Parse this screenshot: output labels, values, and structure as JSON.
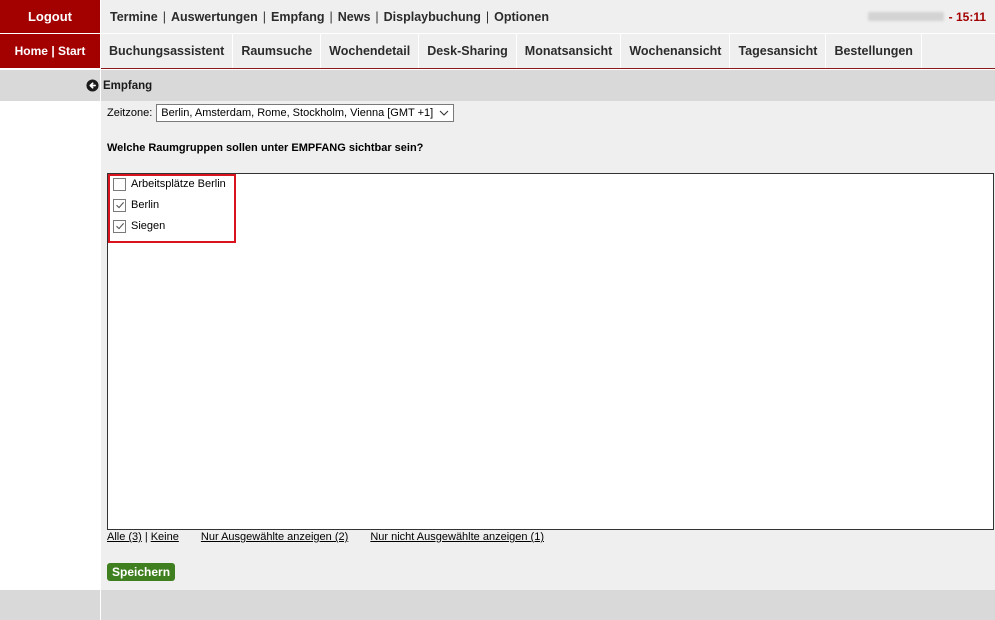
{
  "sidebar": {
    "logout_label": "Logout",
    "home_label": "Home | Start"
  },
  "top_nav": {
    "links": [
      "Termine",
      "Auswertungen",
      "Empfang",
      "News",
      "Displaybuchung",
      "Optionen"
    ],
    "separator": "|",
    "time": "15:11"
  },
  "tabs": [
    "Buchungsassistent",
    "Raumsuche",
    "Wochendetail",
    "Desk-Sharing",
    "Monatsansicht",
    "Wochenansicht",
    "Tagesansicht",
    "Bestellungen"
  ],
  "page": {
    "back_icon": "circle-arrow-left-icon",
    "title": "Empfang"
  },
  "timezone": {
    "label": "Zeitzone:",
    "value": "Berlin, Amsterdam, Rome, Stockholm, Vienna [GMT +1]"
  },
  "question": "Welche Raumgruppen sollen unter EMPFANG sichtbar sein?",
  "room_groups": [
    {
      "label": "Arbeitsplätze Berlin",
      "checked": false
    },
    {
      "label": "Berlin",
      "checked": true
    },
    {
      "label": "Siegen",
      "checked": true
    }
  ],
  "filters": {
    "all": "Alle (3)",
    "pipe": "|",
    "none": "Keine",
    "only_selected": "Nur Ausgewählte anzeigen (2)",
    "only_unselected": "Nur nicht Ausgewählte anzeigen (1)"
  },
  "save_label": "Speichern",
  "colors": {
    "brand_red": "#a30000",
    "save_green": "#3f7f1f",
    "highlight_red": "#d9141e"
  }
}
